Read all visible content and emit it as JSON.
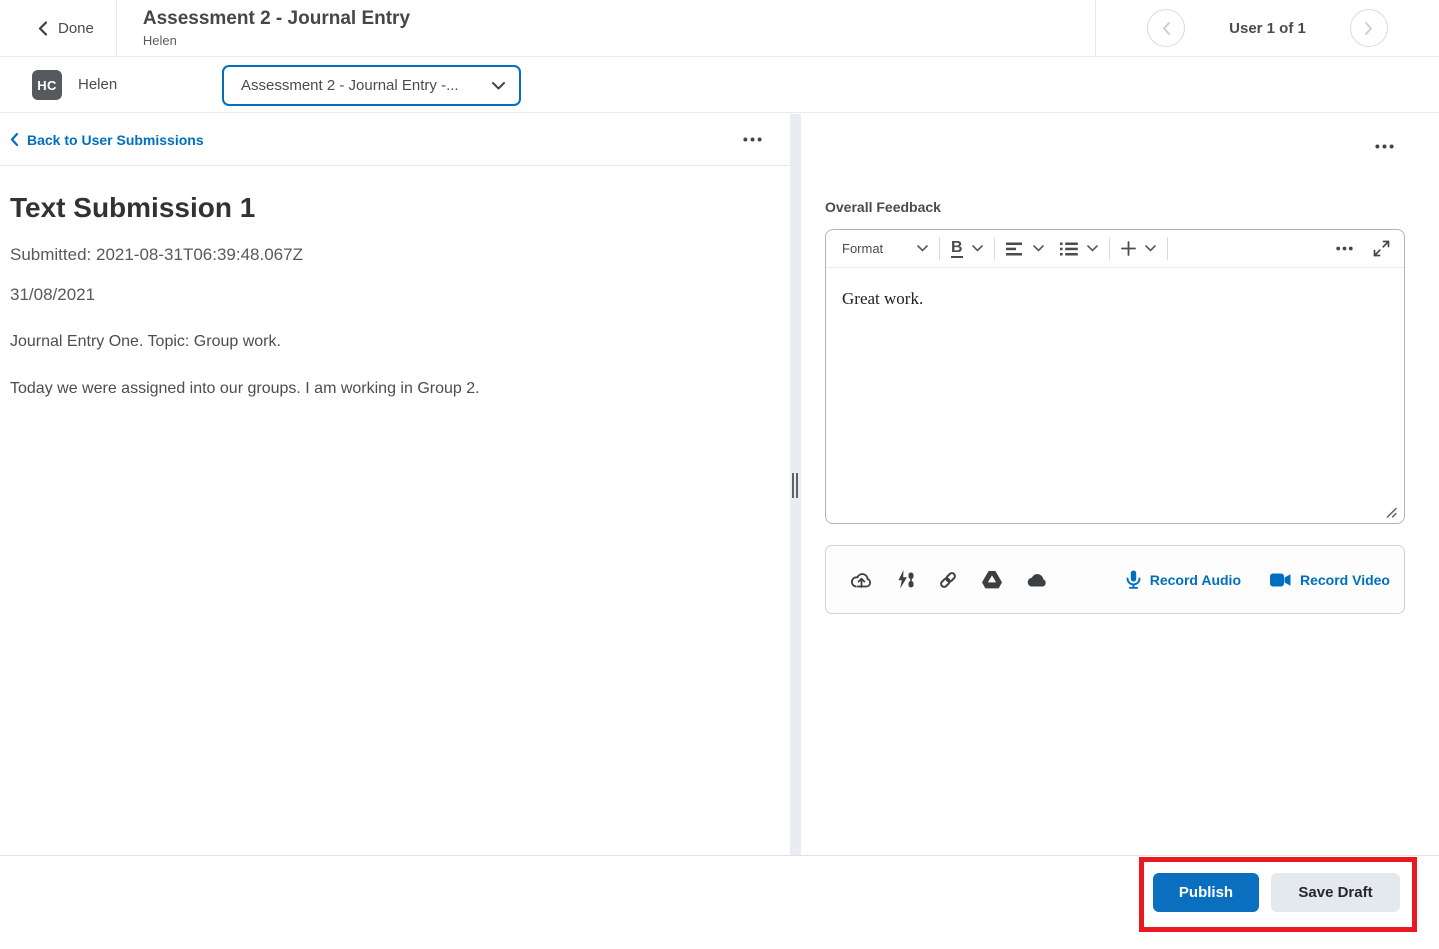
{
  "header": {
    "done_label": "Done",
    "title": "Assessment 2 - Journal Entry",
    "subtitle": "Helen",
    "user_nav_label": "User 1 of 1"
  },
  "user_bar": {
    "avatar_initials": "HC",
    "user_name": "Helen",
    "assessment_selector_value": "Assessment 2 - Journal Entry -..."
  },
  "submission_panel": {
    "back_link_label": "Back to User Submissions",
    "title": "Text Submission 1",
    "submitted_line": "Submitted: 2021-08-31T06:39:48.067Z",
    "date_line": "31/08/2021",
    "paragraphs": [
      "Journal Entry One. Topic: Group work.",
      "Today we were assigned into our groups. I am working in Group 2."
    ]
  },
  "feedback_panel": {
    "label": "Overall Feedback",
    "toolbar": {
      "format_label": "Format",
      "bold_label": "B"
    },
    "editor_content": "Great work.",
    "attachments": {
      "icons": [
        "upload-icon",
        "quicklink-icon",
        "link-icon",
        "google-drive-icon",
        "onedrive-icon"
      ],
      "record_audio_label": "Record Audio",
      "record_video_label": "Record Video"
    }
  },
  "footer": {
    "publish_label": "Publish",
    "save_draft_label": "Save Draft"
  },
  "colors": {
    "accent_blue": "#006fbf",
    "publish_blue": "#0a6fbe",
    "annotation_red": "#e8191f",
    "text_dark": "#494c4e",
    "text_muted": "#56595d",
    "avatar_bg": "#565a5e"
  }
}
